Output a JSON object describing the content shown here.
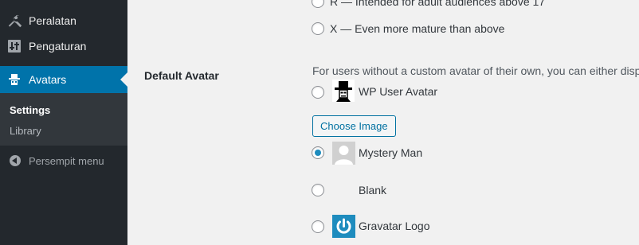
{
  "sidebar": {
    "items": [
      {
        "label": "Peralatan"
      },
      {
        "label": "Pengaturan"
      },
      {
        "label": "Avatars"
      }
    ],
    "submenu": [
      {
        "label": "Settings"
      },
      {
        "label": "Library"
      }
    ],
    "collapse_label": "Persempit menu"
  },
  "ratings": {
    "r_label": "R — Intended for adult audiences above 17",
    "x_label": "X — Even more mature than above"
  },
  "default_avatar": {
    "row_label": "Default Avatar",
    "description": "For users without a custom avatar of their own, you can either display",
    "options": [
      {
        "label": "WP User Avatar",
        "checked": false
      },
      {
        "label": "Mystery Man",
        "checked": true
      },
      {
        "label": "Blank",
        "checked": false
      },
      {
        "label": "Gravatar Logo",
        "checked": false
      }
    ],
    "choose_button": "Choose Image"
  },
  "colors": {
    "sidebar_bg": "#23282d",
    "active_bg": "#0073aa",
    "accent": "#1e8cbe"
  }
}
